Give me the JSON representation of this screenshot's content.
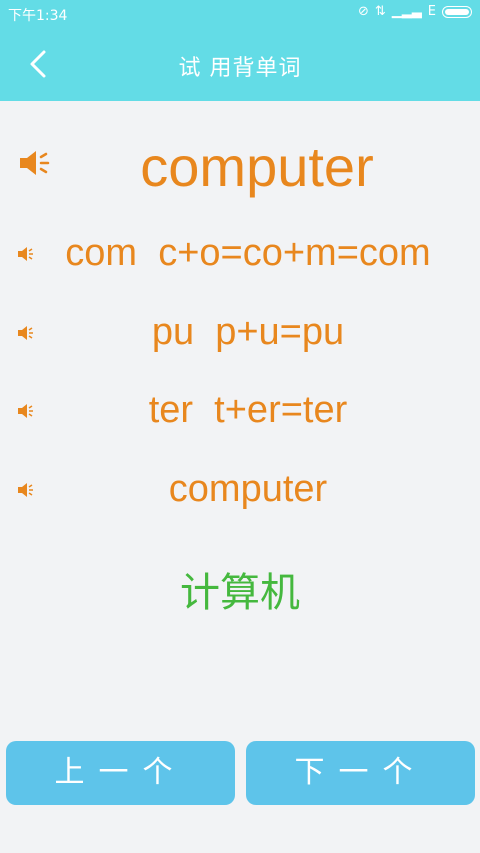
{
  "status_bar": {
    "time": "下午1:34",
    "network": "E"
  },
  "header": {
    "title": "试   用背单词"
  },
  "word": {
    "main": "computer",
    "syllables": [
      {
        "text": "com  c+o=co+m=com"
      },
      {
        "text": "pu  p+u=pu"
      },
      {
        "text": "ter  t+er=ter"
      },
      {
        "text": "computer"
      }
    ],
    "meaning": "计算机"
  },
  "buttons": {
    "prev": "上一个",
    "next": "下一个"
  },
  "colors": {
    "bar": "#63dce6",
    "word": "#e8871e",
    "meaning": "#45b83e",
    "button": "#5ec4ea"
  }
}
